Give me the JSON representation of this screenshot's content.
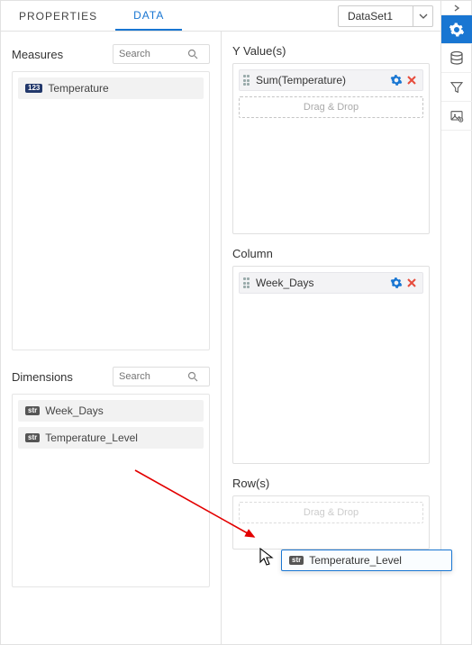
{
  "tabs": {
    "properties": "PROPERTIES",
    "data": "DATA"
  },
  "dataset": {
    "selected": "DataSet1"
  },
  "measures": {
    "title": "Measures",
    "search_placeholder": "Search",
    "items": [
      {
        "type": "123",
        "name": "Temperature"
      }
    ]
  },
  "dimensions": {
    "title": "Dimensions",
    "search_placeholder": "Search",
    "items": [
      {
        "type": "str",
        "name": "Week_Days"
      },
      {
        "type": "str",
        "name": "Temperature_Level"
      }
    ]
  },
  "yvalues": {
    "title": "Y Value(s)",
    "items": [
      {
        "label": "Sum(Temperature)"
      }
    ],
    "drop_hint": "Drag & Drop"
  },
  "column": {
    "title": "Column",
    "items": [
      {
        "label": "Week_Days"
      }
    ]
  },
  "rows": {
    "title": "Row(s)",
    "drop_hint": "Drag & Drop"
  },
  "drag_ghost": {
    "type": "str",
    "name": "Temperature_Level"
  },
  "colors": {
    "accent": "#1976d2",
    "remove": "#e74c3c"
  }
}
